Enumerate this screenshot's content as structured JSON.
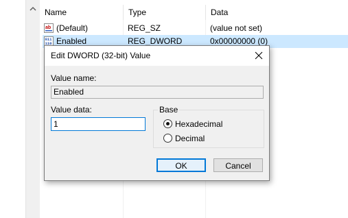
{
  "list": {
    "columns": [
      "Name",
      "Type",
      "Data"
    ],
    "rows": [
      {
        "name": "(Default)",
        "type": "REG_SZ",
        "data": "(value not set)",
        "icon": "string-value-icon"
      },
      {
        "name": "Enabled",
        "type": "REG_DWORD",
        "data": "0x00000000 (0)",
        "icon": "binary-value-icon",
        "selected": true
      }
    ]
  },
  "dialog": {
    "title": "Edit DWORD (32-bit) Value",
    "value_name_label": "Value name:",
    "value_name": "Enabled",
    "value_data_label": "Value data:",
    "value_data": "1",
    "base_label": "Base",
    "base_options": [
      {
        "label": "Hexadecimal",
        "selected": true
      },
      {
        "label": "Decimal",
        "selected": false
      }
    ],
    "ok_label": "OK",
    "cancel_label": "Cancel"
  },
  "colors": {
    "selection": "#cce8ff",
    "accent": "#0078d7",
    "dialog_bg": "#f0f0f0"
  }
}
